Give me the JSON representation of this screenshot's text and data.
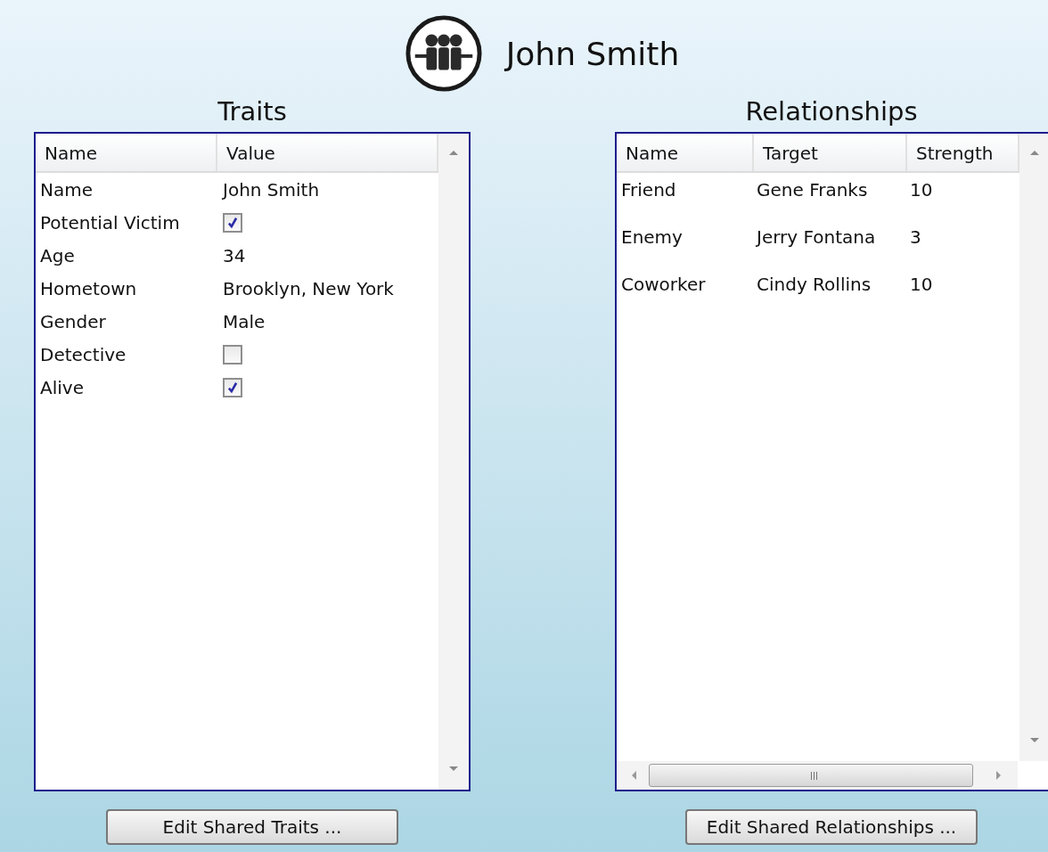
{
  "header": {
    "title": "John Smith"
  },
  "traits": {
    "title": "Traits",
    "columns": [
      "Name",
      "Value"
    ],
    "rows": [
      {
        "name": "Name",
        "kind": "text",
        "value": "John Smith"
      },
      {
        "name": "Potential Victim",
        "kind": "checkbox",
        "checked": true
      },
      {
        "name": "Age",
        "kind": "text",
        "value": "34"
      },
      {
        "name": "Hometown",
        "kind": "text",
        "value": "Brooklyn, New York"
      },
      {
        "name": "Gender",
        "kind": "text",
        "value": "Male"
      },
      {
        "name": "Detective",
        "kind": "checkbox",
        "checked": false
      },
      {
        "name": "Alive",
        "kind": "checkbox",
        "checked": true
      }
    ],
    "button": "Edit Shared Traits ..."
  },
  "relationships": {
    "title": "Relationships",
    "columns": [
      "Name",
      "Target",
      "Strength"
    ],
    "rows": [
      {
        "name": "Friend",
        "target": "Gene Franks",
        "strength": "10"
      },
      {
        "name": "Enemy",
        "target": "Jerry Fontana",
        "strength": "3"
      },
      {
        "name": "Coworker",
        "target": "Cindy Rollins",
        "strength": "10"
      }
    ],
    "button": "Edit Shared Relationships ..."
  }
}
